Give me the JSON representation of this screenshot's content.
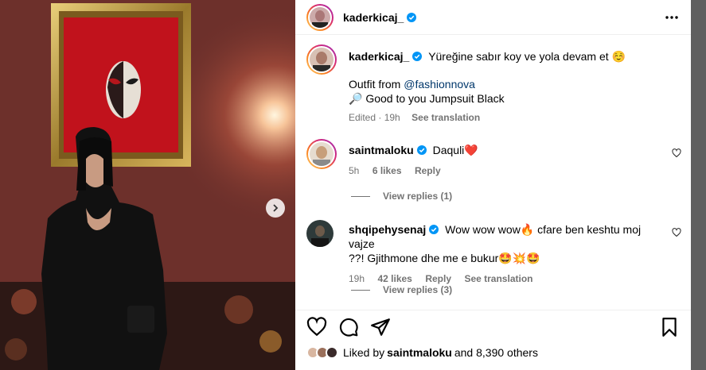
{
  "header": {
    "username": "kaderkicaj_",
    "more_icon": "more-horizontal-icon"
  },
  "caption": {
    "username": "kaderkicaj_",
    "line1": "Yüreğine sabır koy ve yola devam et ☺️",
    "outfit_prefix": "Outfit from ",
    "outfit_mention": "@fashionnova",
    "line3": "🔎 Good to you Jumpsuit Black",
    "meta_edited": "Edited · 19h",
    "see_translation": "See translation"
  },
  "comments": [
    {
      "username": "saintmaloku",
      "text": "Daquli❤️",
      "time": "5h",
      "likes": "6 likes",
      "reply": "Reply",
      "view_replies": "View replies (1)"
    },
    {
      "username": "shqipehysenaj",
      "text_line1": "Wow wow wow🔥 cfare ben keshtu moj vajze",
      "text_line2": "??! Gjithmone dhe me e bukur🤩💥🤩",
      "time": "19h",
      "likes": "42 likes",
      "reply": "Reply",
      "see_translation": "See translation",
      "view_replies": "View replies (3)"
    }
  ],
  "likes_line": {
    "prefix": "Liked by ",
    "user": "saintmaloku",
    "suffix": " and 8,390 others"
  },
  "colors": {
    "link": "#00376b",
    "muted": "#737373",
    "wall": "#6b2f2a",
    "heart": "#ed4956"
  }
}
